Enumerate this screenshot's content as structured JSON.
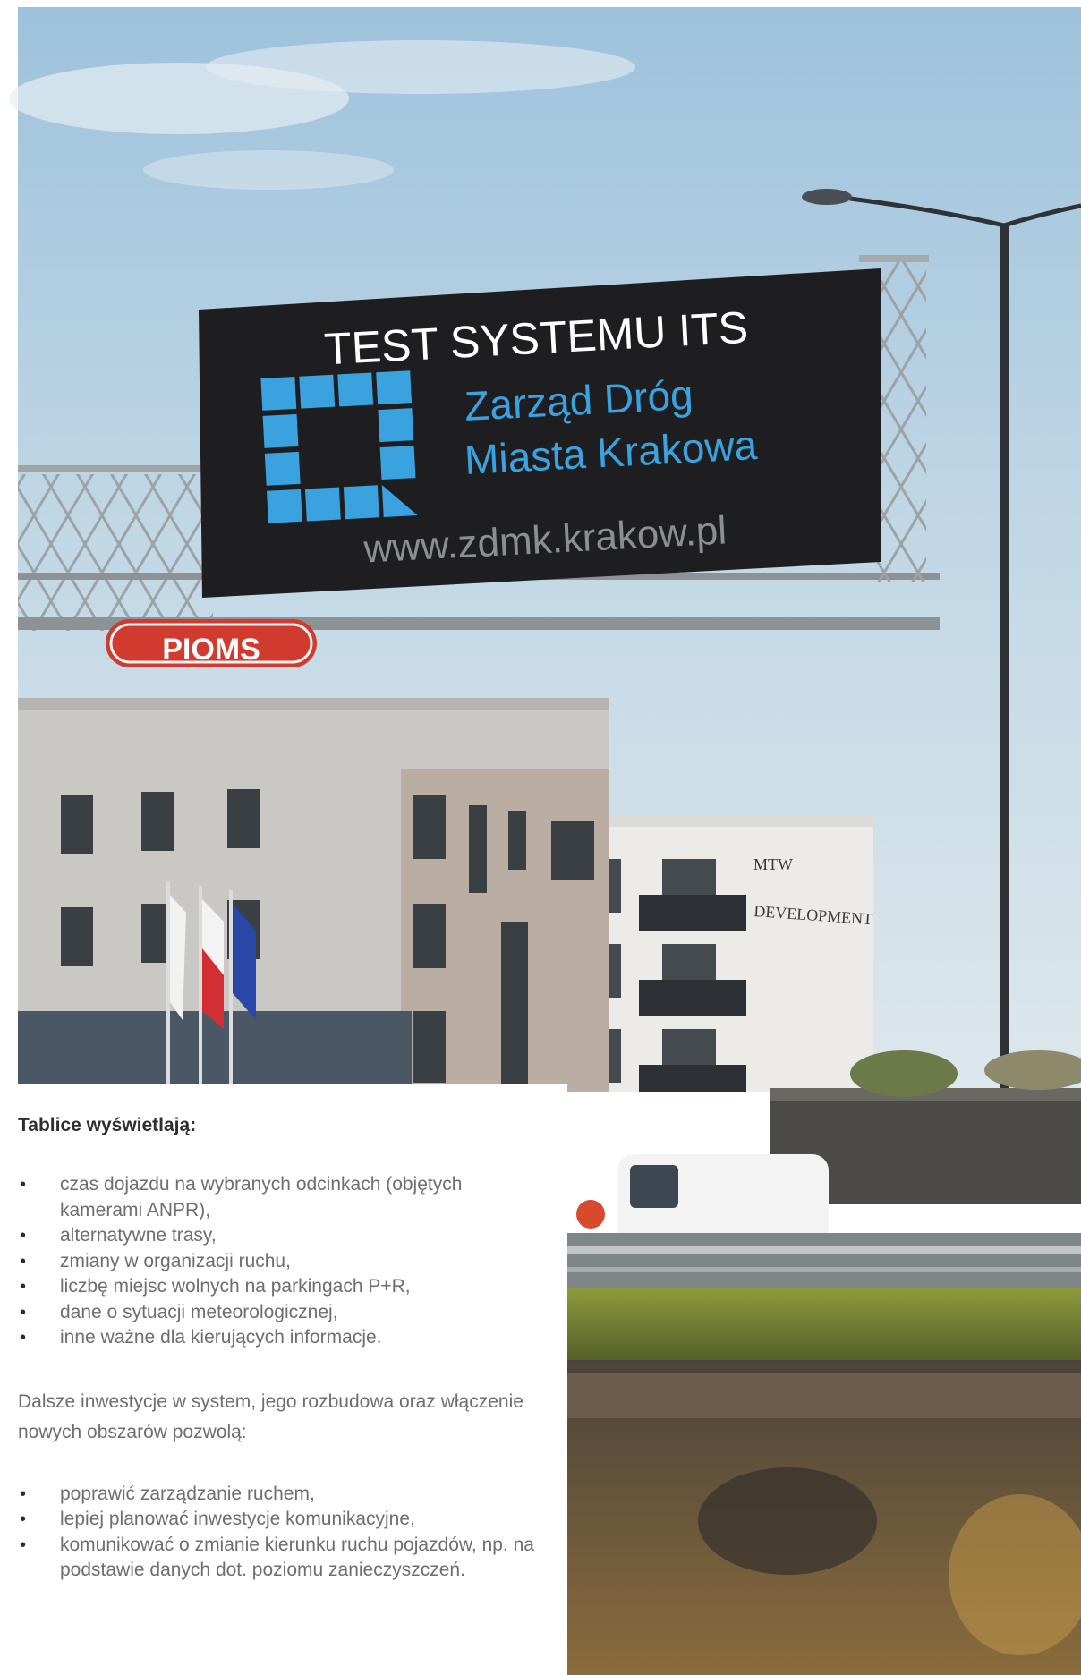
{
  "sign": {
    "headline": "TEST SYSTEMU ITS",
    "org_line1": "Zarząd Dróg",
    "org_line2": "Miasta Krakowa",
    "url": "www.zdmk.krakow.pl"
  },
  "rooftop_sign": "PIOMS",
  "building_sign": {
    "line1": "MTW",
    "line2": "DEVELOPMENT"
  },
  "panel": {
    "heading": "Tablice wyświetlają:",
    "list1": [
      "czas dojazdu na wybranych odcinkach (objętych kamerami ANPR),",
      "alternatywne trasy,",
      "zmiany w organizacji ruchu,",
      "liczbę miejsc wolnych na parkingach P+R,",
      "dane o sytuacji meteorologicznej,",
      "inne ważne dla kierujących informacje."
    ],
    "paragraph": "Dalsze inwestycje w system, jego rozbudowa oraz włączenie nowych obszarów pozwolą:",
    "list2": [
      "poprawić zarządzanie ruchem,",
      "lepiej planować inwestycje komunikacyjne,",
      "komunikować o zmianie kierunku ruchu pojazdów, np. na podstawie danych dot. poziomu zanieczyszczeń."
    ]
  },
  "colors": {
    "sky": "#b9d4e6",
    "sign_board": "#1e1e21",
    "sign_text": "#ffffff",
    "logo_blue": "#3aa2de",
    "url_gray": "#8a8f93"
  }
}
